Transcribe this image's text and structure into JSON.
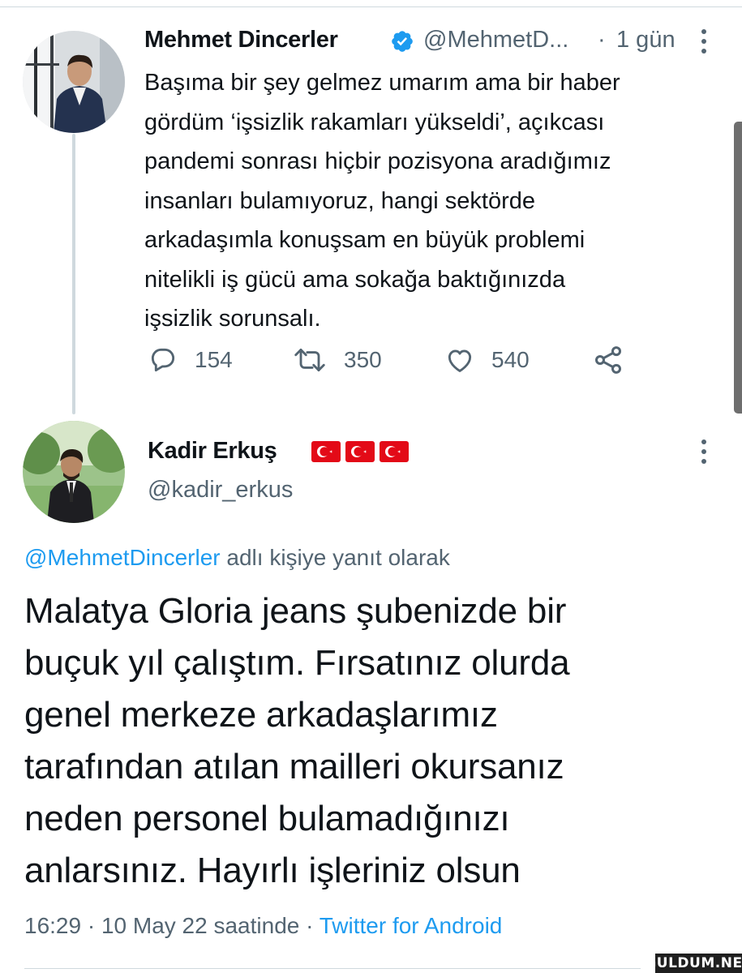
{
  "tweet1": {
    "author_name": "Mehmet Dincerler",
    "author_handle": "@MehmetD...",
    "separator": "·",
    "time_ago": "1 gün",
    "text": "Başıma bir şey gelmez umarım ama bir haber\ngördüm ‘işsizlik rakamları yükseldi’, açıkcası\npandemi sonrası hiçbir pozisyona aradığımız\ninsanları bulamıyoruz, hangi sektörde\narkadaşımla konuşsam en büyük problemi\nnitelikli iş gücü ama sokağa baktığınızda\nişsizlik sorunsalı.",
    "actions": {
      "replies": "154",
      "retweets": "350",
      "likes": "540"
    }
  },
  "tweet2": {
    "author_name": "Kadir Erkuş",
    "author_handle": "@kadir_erkus",
    "reply_to_mention": "@MehmetDincerler",
    "reply_to_suffix": " adlı kişiye yanıt olarak",
    "text": "Malatya Gloria jeans şubenizde bir\nbuçuk yıl çalıştım. Fırsatınız olurda\ngenel merkeze arkadaşlarımız\ntarafından atılan mailleri okursanız\nneden personel bulamadığınızı\nanlarsınız. Hayırlı işleriniz olsun",
    "timestamp": "16:29 · 10 May 22 saatinde · ",
    "source": "Twitter for Android"
  },
  "icons": {
    "verified": "verified-badge-icon",
    "reply": "reply-bubble-icon",
    "retweet": "retweet-arrows-icon",
    "like": "heart-icon",
    "share": "share-icon",
    "more": "more-vertical-icon",
    "flag": "turkey-flag-icon"
  },
  "watermark": "GULDUM.NET",
  "colors": {
    "accent": "#1d9bf0",
    "secondary_text": "#536471",
    "primary_text": "#0f1419",
    "flag_red": "#e30a17"
  }
}
